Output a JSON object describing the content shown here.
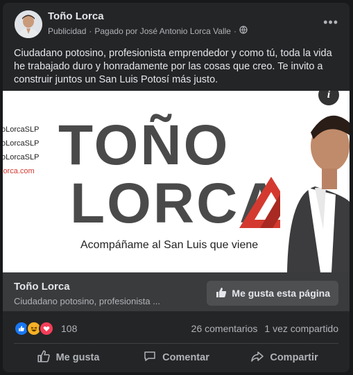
{
  "post": {
    "author": "Toño Lorca",
    "meta_sponsored": "Publicidad",
    "meta_dot": "·",
    "meta_paid": "Pagado por José Antonio Lorca Valle",
    "meta_dot2": "·",
    "more_icon": "more-horizontal-icon",
    "text": "Ciudadano potosino, profesionista emprendedor y como tú, toda la vida he trabajado duro y honradamente por las cosas que creo. Te invito a construir juntos un San Luis Potosí más justo."
  },
  "ad_image": {
    "link1": "oLorcaSLP",
    "link2": "oLorcaSLP",
    "link3": "oLorcaSLP",
    "web": "lorca.com",
    "title_line1": "TOÑO",
    "title_line2": "LORCA",
    "tagline": "Acompáñame al San Luis que viene",
    "info_label": "i",
    "accent_color": "#d4392f"
  },
  "page_bar": {
    "name": "Toño Lorca",
    "description": "Ciudadano potosino, profesionista ...",
    "like_button": "Me gusta esta página"
  },
  "stats": {
    "reaction_count": "108",
    "comments": "26 comentarios",
    "shares": "1 vez compartido",
    "reactions": [
      "like",
      "haha",
      "love"
    ]
  },
  "actions": {
    "like": "Me gusta",
    "comment": "Comentar",
    "share": "Compartir"
  }
}
